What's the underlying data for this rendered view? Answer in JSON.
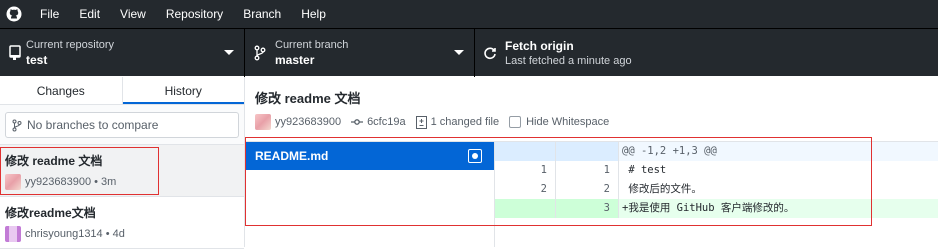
{
  "menubar": {
    "items": [
      "File",
      "Edit",
      "View",
      "Repository",
      "Branch",
      "Help"
    ]
  },
  "toolbar": {
    "repo_label": "Current repository",
    "repo_value": "test",
    "branch_label": "Current branch",
    "branch_value": "master",
    "fetch_label": "Fetch origin",
    "fetch_sub": "Last fetched a minute ago"
  },
  "sidebar": {
    "tabs": [
      "Changes",
      "History"
    ],
    "active_tab": "History",
    "compare_placeholder": "No branches to compare",
    "commits": [
      {
        "title": "修改 readme 文档",
        "author": "yy923683900",
        "time": "3m"
      },
      {
        "title": "修改readme文档",
        "author": "chrisyoung1314",
        "time": "4d"
      }
    ]
  },
  "main": {
    "title": "修改 readme 文档",
    "author": "yy923683900",
    "sha": "6cfc19a",
    "changed_files": "1 changed file",
    "hide_whitespace": "Hide Whitespace",
    "file": "README.md"
  },
  "diff": {
    "rows": [
      {
        "type": "hunk",
        "old": "",
        "new": "",
        "code": "@@ -1,2 +1,3 @@"
      },
      {
        "type": "context",
        "old": "1",
        "new": "1",
        "code": " # test"
      },
      {
        "type": "context",
        "old": "2",
        "new": "2",
        "code": " 修改后的文件。"
      },
      {
        "type": "add",
        "old": "",
        "new": "3",
        "code": "+我是使用 GitHub 客户端修改的。"
      }
    ]
  },
  "colors": {
    "toolbar_bg": "#24292e",
    "selected_file_bg": "#0366d6",
    "add_bg": "#e6ffed",
    "highlight": "#e03131"
  }
}
